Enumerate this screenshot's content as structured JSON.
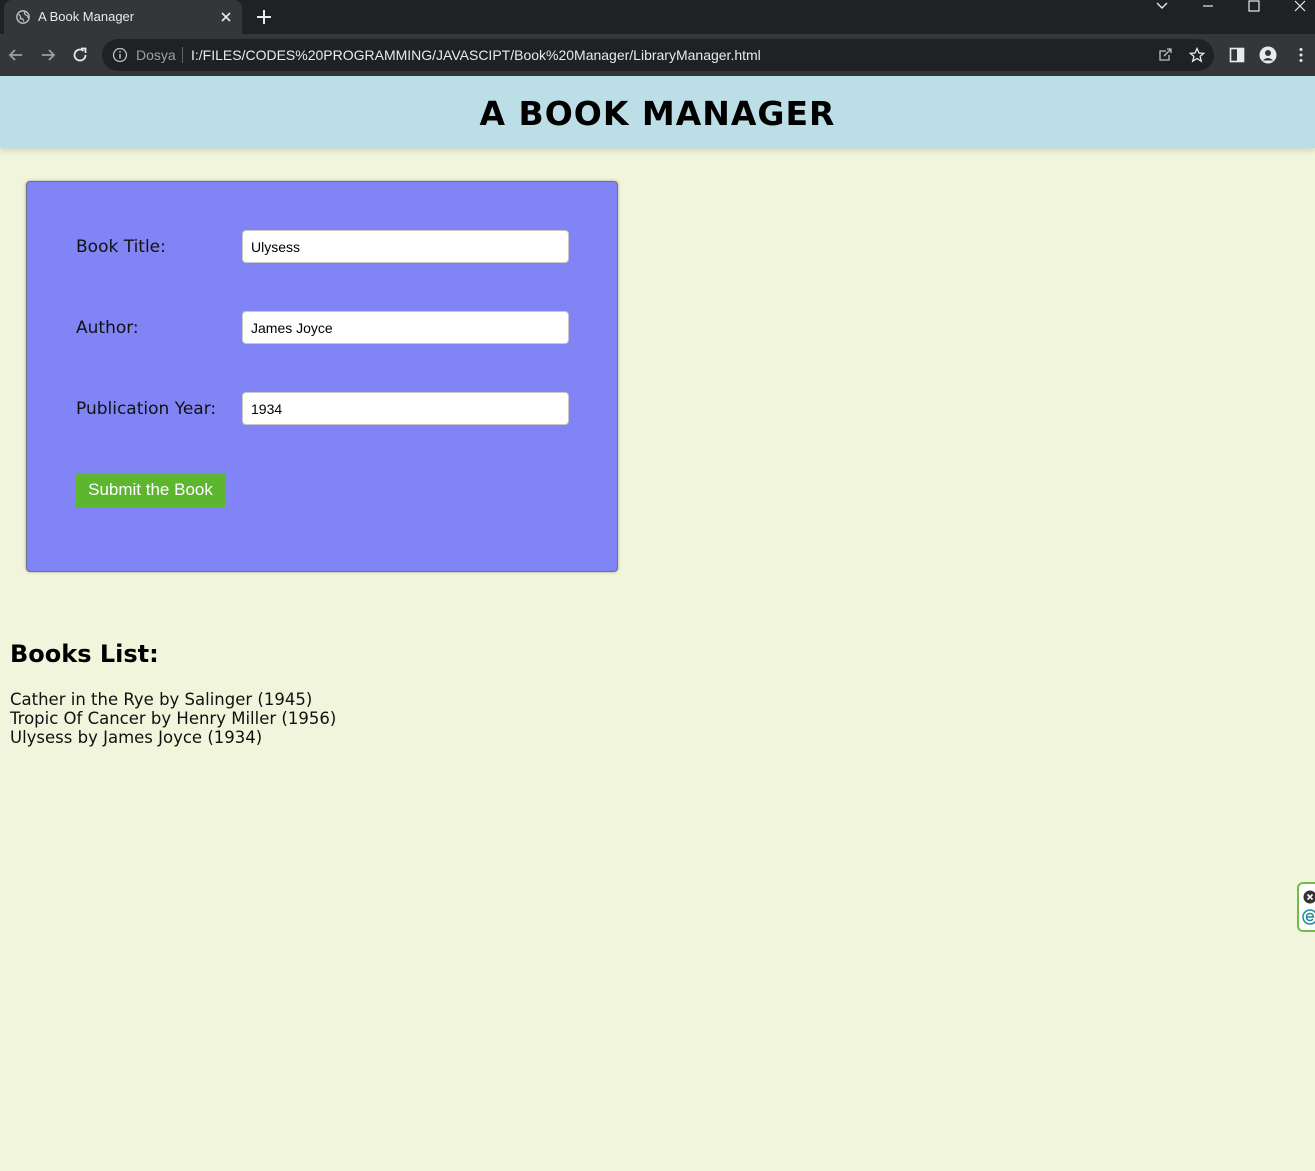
{
  "browser": {
    "tab_title": "A Book Manager",
    "site_info_label": "Dosya",
    "url": "I:/FILES/CODES%20PROGRAMMING/JAVASCIPT/Book%20Manager/LibraryManager.html"
  },
  "header": {
    "title": "A BOOK MANAGER"
  },
  "form": {
    "title_label": "Book Title:",
    "title_value": "Ulysess",
    "author_label": "Author:",
    "author_value": "James Joyce",
    "year_label": "Publication Year:",
    "year_value": "1934",
    "submit_label": "Submit the Book"
  },
  "books": {
    "heading": "Books List:",
    "items": [
      "Cather in the Rye by Salinger (1945)",
      "Tropic Of Cancer by Henry Miller (1956)",
      "Ulysess by James Joyce (1934)"
    ]
  },
  "colors": {
    "page_bg": "#f1f5dc",
    "header_bg": "#bcdfe7",
    "form_bg": "#8084f4",
    "button_bg": "#5db530"
  },
  "icons": [
    "globe-icon",
    "close-icon",
    "plus-icon",
    "back-icon",
    "forward-icon",
    "reload-icon",
    "info-icon",
    "share-icon",
    "star-icon",
    "sidebar-icon",
    "profile-icon",
    "menu-icon"
  ]
}
